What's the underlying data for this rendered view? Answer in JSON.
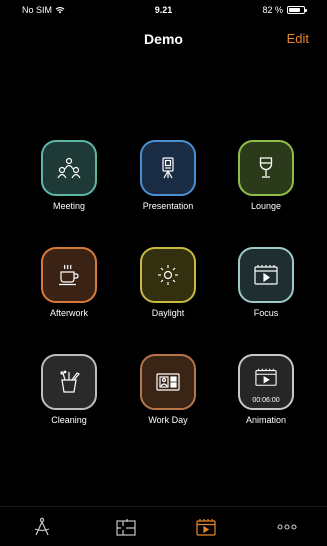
{
  "status_bar": {
    "carrier": "No SIM",
    "time": "9.21",
    "battery": "82 %"
  },
  "nav": {
    "title": "Demo",
    "edit_label": "Edit"
  },
  "scenes": [
    {
      "label": "Meeting",
      "icon": "meeting-icon",
      "color": "#5bb8a2",
      "bg": "#1f3a36"
    },
    {
      "label": "Presentation",
      "icon": "presentation-icon",
      "color": "#4a8fd0",
      "bg": "#1a2c44"
    },
    {
      "label": "Lounge",
      "icon": "wine-glass-icon",
      "color": "#8fbf4a",
      "bg": "#2a3a1a"
    },
    {
      "label": "Afterwork",
      "icon": "coffee-cup-icon",
      "color": "#d7793a",
      "bg": "#3a2314"
    },
    {
      "label": "Daylight",
      "icon": "sun-icon",
      "color": "#c9b842",
      "bg": "#33300f"
    },
    {
      "label": "Focus",
      "icon": "clapperboard-icon",
      "color": "#9fc9c9",
      "bg": "#1f2e30"
    },
    {
      "label": "Cleaning",
      "icon": "cleaning-bucket-icon",
      "color": "#bdbdbd",
      "bg": "#2a2a2a"
    },
    {
      "label": "Work Day",
      "icon": "id-card-icon",
      "color": "#b5764a",
      "bg": "#3a2416"
    },
    {
      "label": "Animation",
      "icon": "clapperboard-icon",
      "color": "#c8c8c8",
      "bg": "#262626",
      "timer": "00:06:00"
    }
  ],
  "tabs": [
    {
      "name": "tab-people",
      "icon": "person-compass-icon",
      "active": false
    },
    {
      "name": "tab-rooms",
      "icon": "floor-plan-icon",
      "active": false
    },
    {
      "name": "tab-scenes",
      "icon": "clapperboard-icon",
      "active": true
    },
    {
      "name": "tab-more",
      "icon": "more-dots-icon",
      "active": false
    }
  ],
  "colors": {
    "accent": "#e8872b",
    "inactive_tab": "#c8c8c8"
  }
}
